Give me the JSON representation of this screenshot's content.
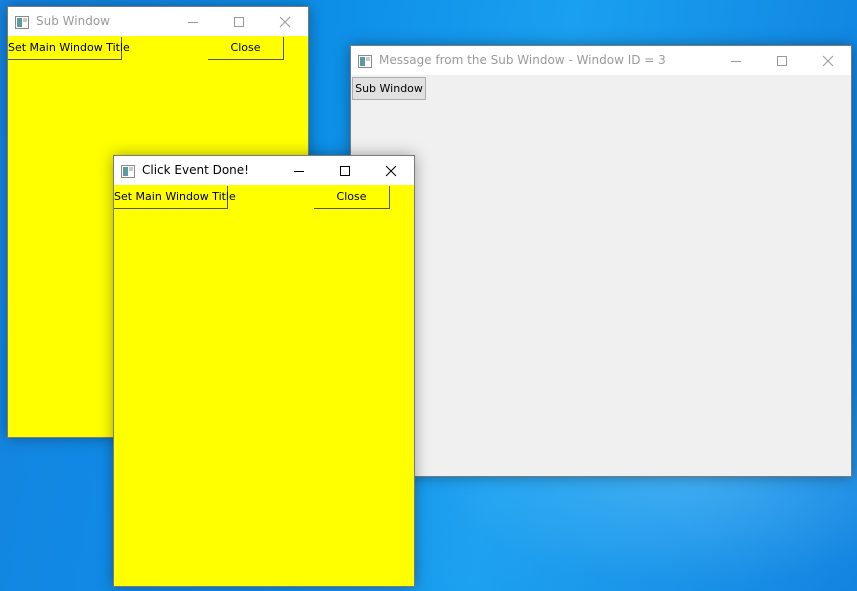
{
  "colors": {
    "sub_window_bg": "#FFFF00",
    "main_window_bg": "#F0F0F0",
    "titlebar_bg": "#FFFFFF",
    "inactive_title_text": "#9A9A9A",
    "active_title_text": "#000000"
  },
  "main_window": {
    "title": "Message from the Sub Window - Window ID = 3",
    "state": "inactive",
    "icon": "qt-app-icon",
    "buttons": {
      "sub_window": "Sub Window"
    }
  },
  "sub_window_back": {
    "title": "Sub Window",
    "state": "inactive",
    "icon": "qt-app-icon",
    "buttons": {
      "set_title": "Set Main Window Title",
      "close": "Close"
    }
  },
  "sub_window_front": {
    "title": "Click Event Done!",
    "state": "active",
    "icon": "qt-app-icon",
    "buttons": {
      "set_title": "Set Main Window Title",
      "close": "Close"
    }
  },
  "title_controls": [
    "minimize-icon",
    "maximize-icon",
    "close-icon"
  ]
}
